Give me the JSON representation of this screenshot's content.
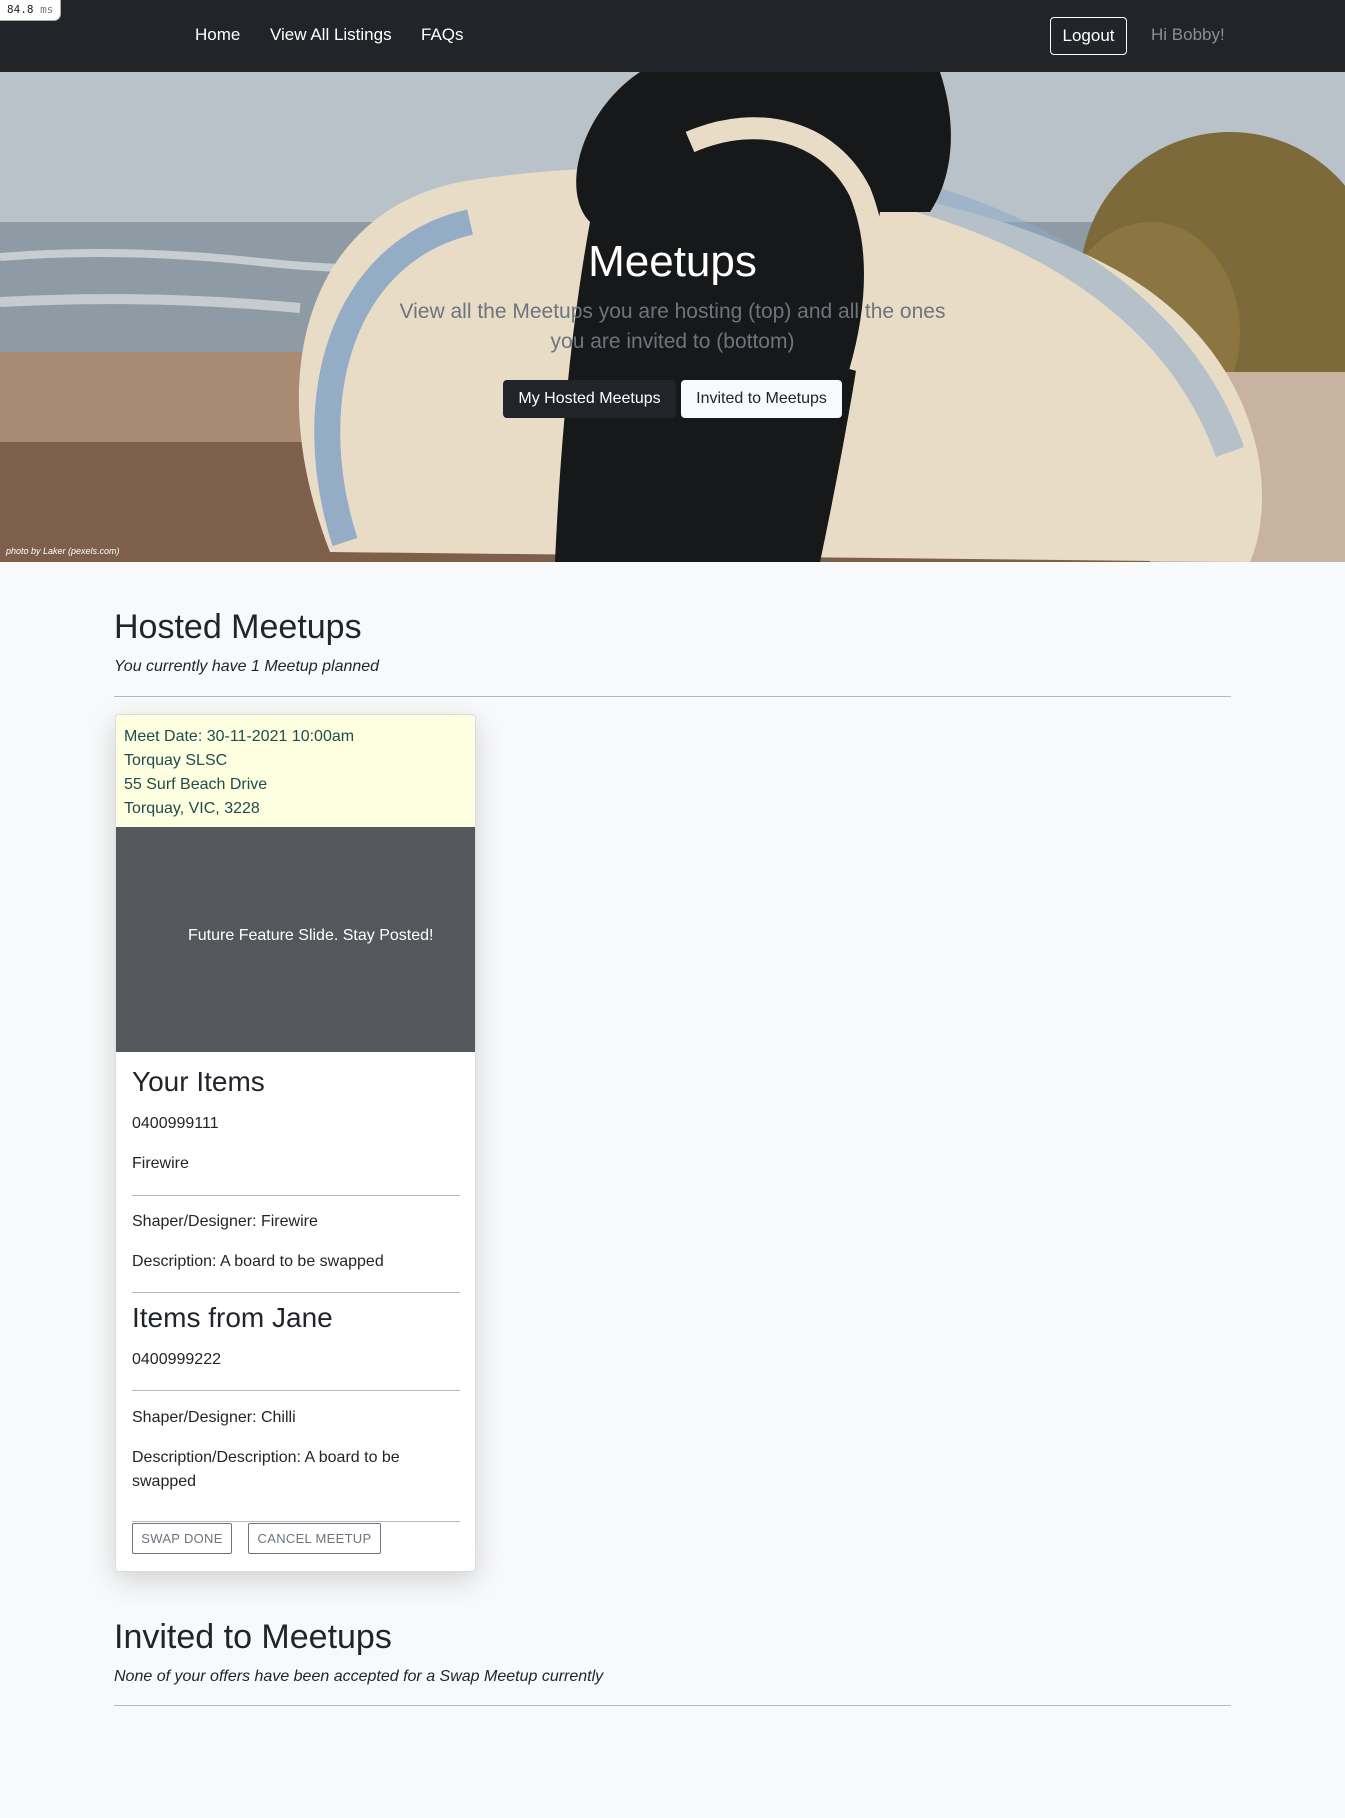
{
  "perf": {
    "value": "84.8",
    "unit": "ms"
  },
  "nav": {
    "links": [
      "Home",
      "View All Listings",
      "FAQs"
    ],
    "logout": "Logout",
    "greeting": "Hi Bobby!"
  },
  "hero": {
    "title": "Meetups",
    "subtitle": "View all the Meetups you are hosting (top) and all the ones you are invited to (bottom)",
    "btn_hosted": "My Hosted Meetups",
    "btn_invited": "Invited to Meetups",
    "credit": "photo by Laker (pexels.com)"
  },
  "hosted": {
    "title": "Hosted Meetups",
    "subtitle": "You currently have 1 Meetup planned",
    "card": {
      "meet_date": "Meet Date: 30-11-2021 10:00am",
      "location": "Torquay SLSC",
      "street": "55 Surf Beach Drive",
      "city": "Torquay, VIC, 3228",
      "slide_text": "Future Feature Slide. Stay Posted!",
      "your_items_title": "Your Items",
      "your_phone": "0400999111",
      "your_item_name": "Firewire",
      "your_shaper": "Shaper/Designer: Firewire",
      "your_description": "Description: A board to be swapped",
      "their_items_title": "Items from Jane",
      "their_phone": "0400999222",
      "their_shaper": "Shaper/Designer: Chilli",
      "their_description": "Description/Description: A board to be swapped",
      "swap_done": "SWAP DONE",
      "cancel": "CANCEL MEETUP"
    }
  },
  "invited": {
    "title": "Invited to Meetups",
    "subtitle": "None of your offers have been accepted for a Swap Meetup currently"
  }
}
